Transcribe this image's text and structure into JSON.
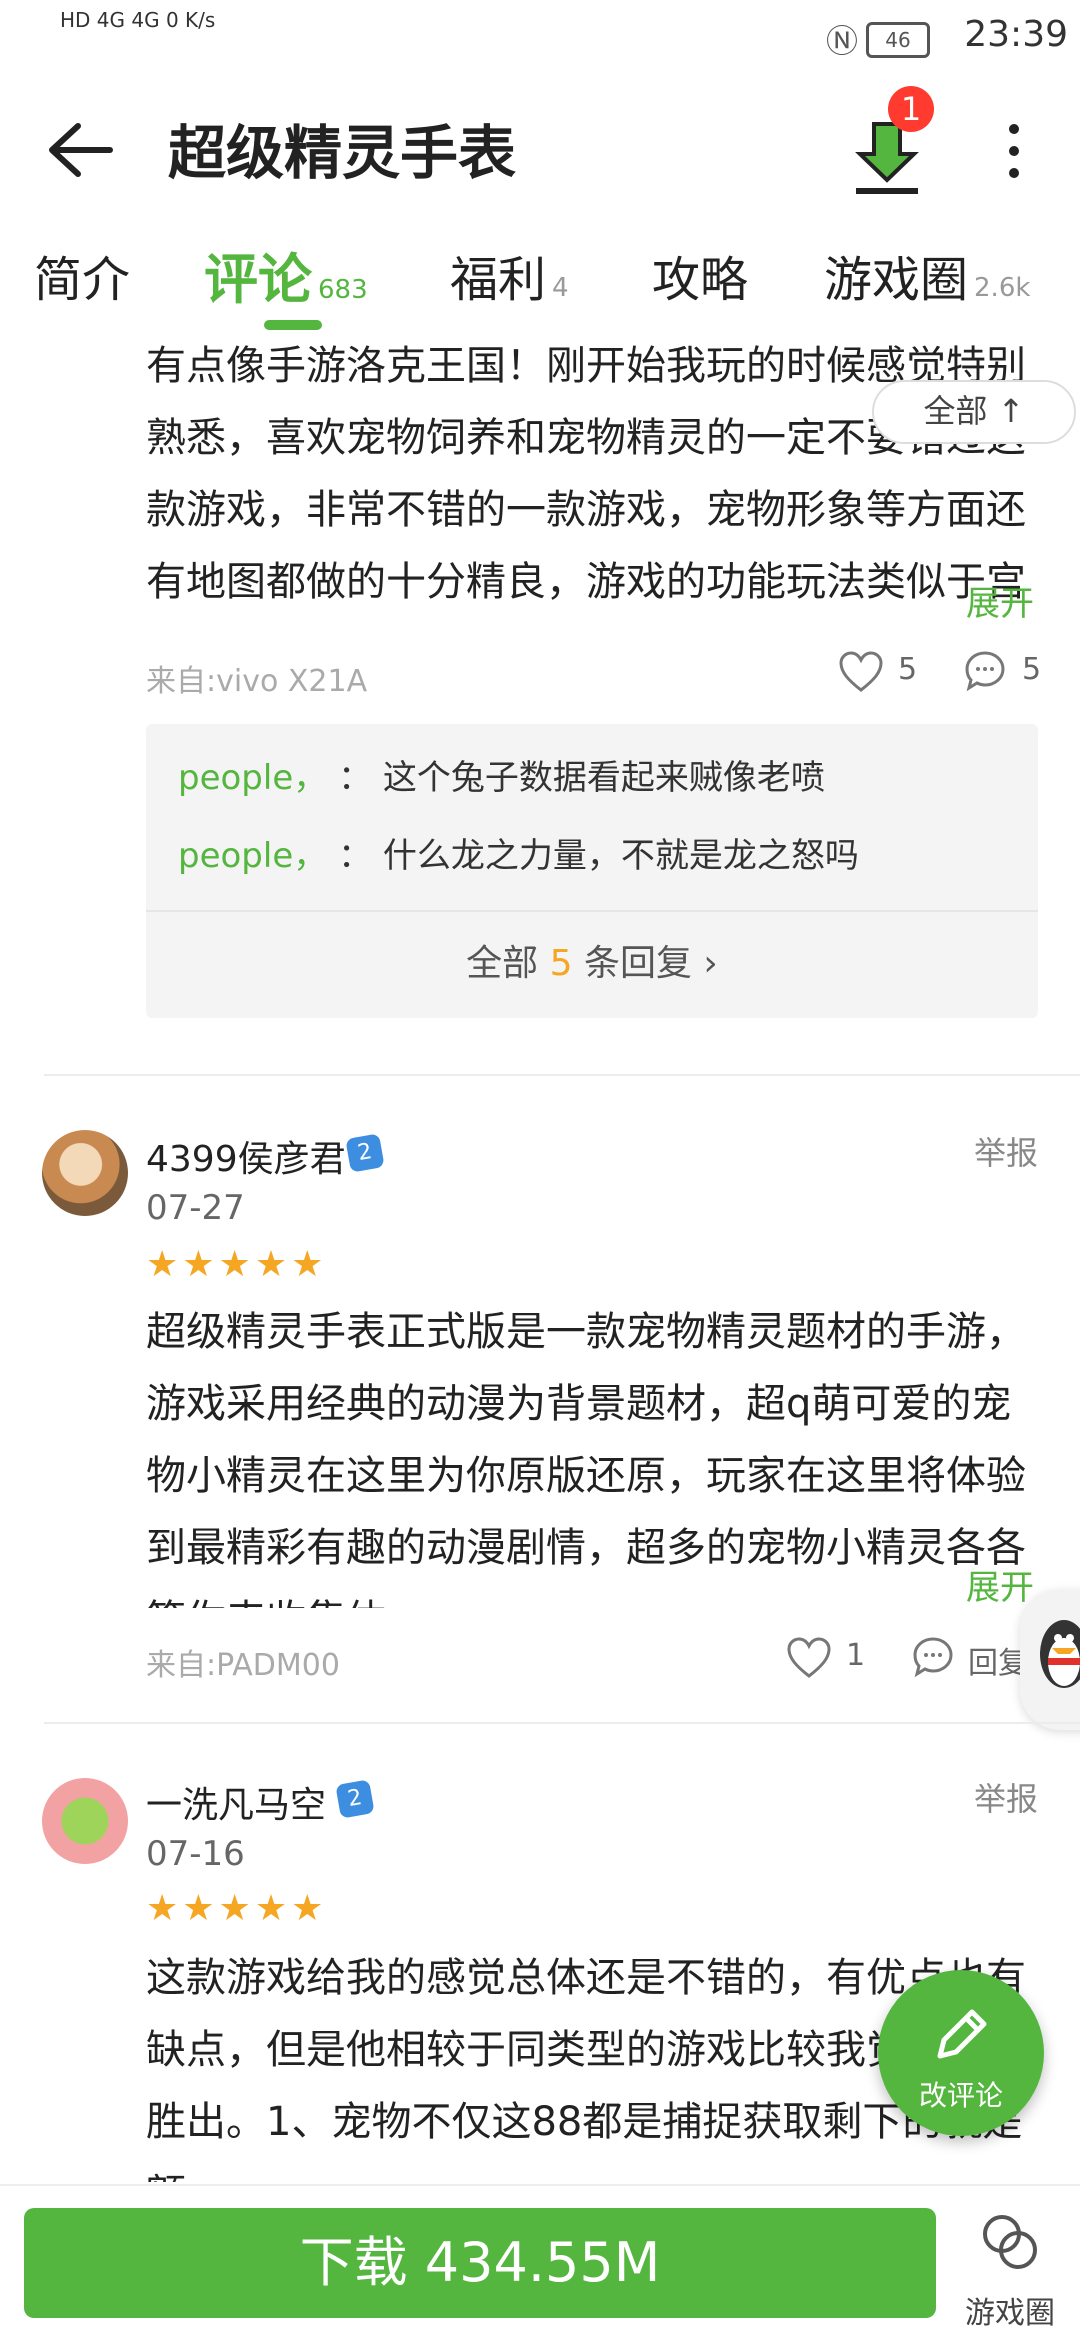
{
  "status_bar": {
    "left_text": "HD 4G 4G 0 K/s",
    "battery": "46",
    "time": "23:39"
  },
  "header": {
    "title": "超级精灵手表",
    "download_badge": "1"
  },
  "tabs": [
    {
      "label": "简介",
      "count": ""
    },
    {
      "label": "评论",
      "count": "683"
    },
    {
      "label": "福利",
      "count": "4"
    },
    {
      "label": "攻略",
      "count": ""
    },
    {
      "label": "游戏圈",
      "count": "2.6k"
    }
  ],
  "comment1": {
    "text": "有点像手游洛克王国！刚开始我玩的时候感觉特别熟悉，喜欢宠物饲养和宠物精灵的一定不要错过这款游戏，非常不错的一款游戏，宠物形象等方面还有地图都做的十分精良，游戏的功能玩法类似于宫自由的宠",
    "fold_label": "全部 ↑",
    "expand": "展开",
    "source": "来自:vivo X21A",
    "likes": "5",
    "replies": "5",
    "reply_list": [
      {
        "who": "people，",
        "sep": "：",
        "text": "这个兔子数据看起来贼像老喷"
      },
      {
        "who": "people，",
        "sep": "：",
        "text": "什么龙之力量，不就是龙之怒吗"
      }
    ],
    "reply_all_pre": "全部 ",
    "reply_all_num": "5",
    "reply_all_post": " 条回复 ›"
  },
  "comment2": {
    "user": "4399侯彦君",
    "level": "2",
    "date": "07-27",
    "report": "举报",
    "stars": "★★★★★",
    "text": "超级精灵手表正式版是一款宠物精灵题材的手游，游戏采用经典的动漫为背景题材，超q萌可爱的宠物小精灵在这里为你原版还原，玩家在这里将体验到最精彩有趣的动漫剧情，超多的宠物小精灵各各等你来收集体",
    "expand": "展开",
    "source": "来自:PADM00",
    "likes": "1",
    "reply_label": "回复"
  },
  "comment3": {
    "user": "一洗凡马空",
    "level": "2",
    "date": "07-16",
    "report": "举报",
    "stars": "★★★★★",
    "text": "这款游戏给我的感觉总体还是不错的，有优点也有缺点，但是他相较于同类型的游戏比较我觉得他能胜出。1、宠物不仅这88都是捕捉获取剩下的就是额"
  },
  "fab": {
    "label": "改评论"
  },
  "bottom": {
    "download_label": "下载 434.55M",
    "circle_label": "游戏圈"
  },
  "colors": {
    "accent": "#54b63f",
    "badge": "#ff3b30",
    "star": "#f5a623"
  }
}
